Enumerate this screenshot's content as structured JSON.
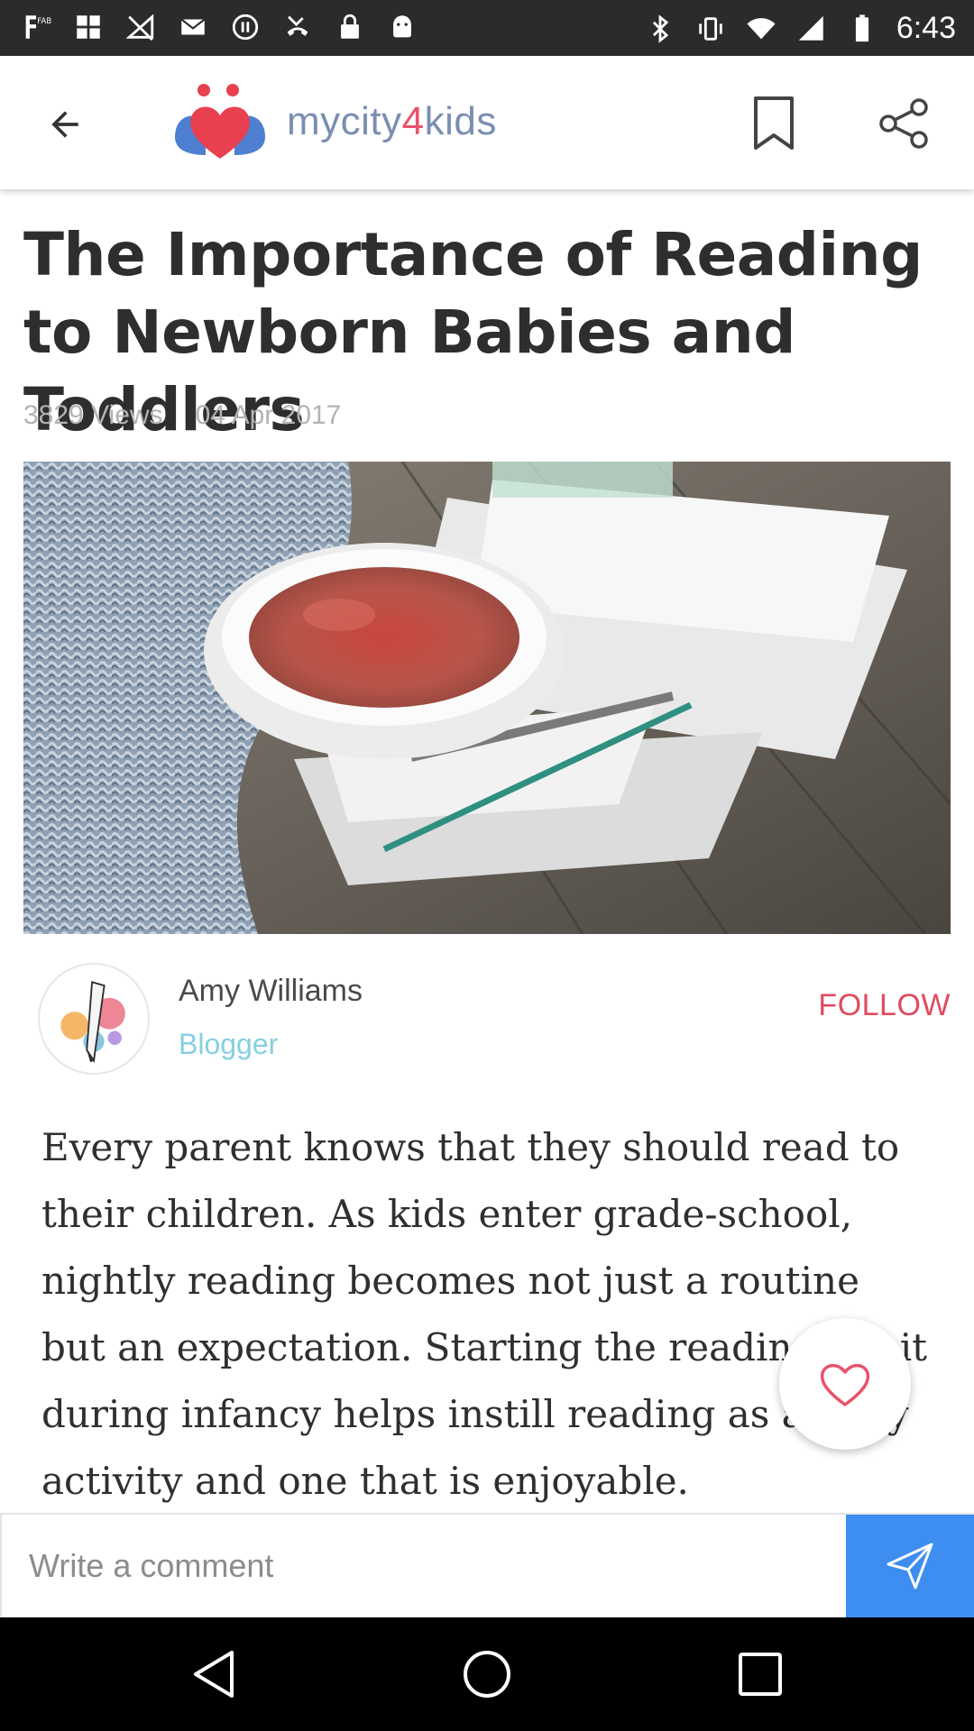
{
  "status_bar": {
    "time": "6:43",
    "left_icons": [
      "fab-icon",
      "grid-icon",
      "no-signal-icon",
      "mail-icon",
      "record-icon",
      "missed-call-icon",
      "lock-icon",
      "android-icon"
    ],
    "right_icons": [
      "bluetooth-icon",
      "vibrate-icon",
      "wifi-icon",
      "signal-icon",
      "battery-icon"
    ]
  },
  "app_bar": {
    "logo_text_prefix": "mycity",
    "logo_text_four": "4",
    "logo_text_suffix": "kids",
    "brand_colors": {
      "heart_red": "#e8404f",
      "heart_blue": "#4f7fd1",
      "text": "#7a8fb0"
    }
  },
  "article": {
    "title": "The Importance of Reading to Newborn Babies and Toddlers",
    "views": "3829 Views",
    "date": "04 Apr 2017",
    "author": {
      "name": "Amy Williams",
      "role": "Blogger",
      "follow_label": "FOLLOW"
    },
    "body": "Every parent knows that they should read to their children. As kids enter grade-school, nightly reading becomes not just a routine but an expectation. Starting the reading habit during infancy helps instill reading as a daily activity and one that is enjoyable."
  },
  "comment": {
    "placeholder": "Write a comment"
  },
  "colors": {
    "accent_red": "#e04b5e",
    "send_blue": "#3d8ef0",
    "role_blue": "#86cfe0"
  }
}
